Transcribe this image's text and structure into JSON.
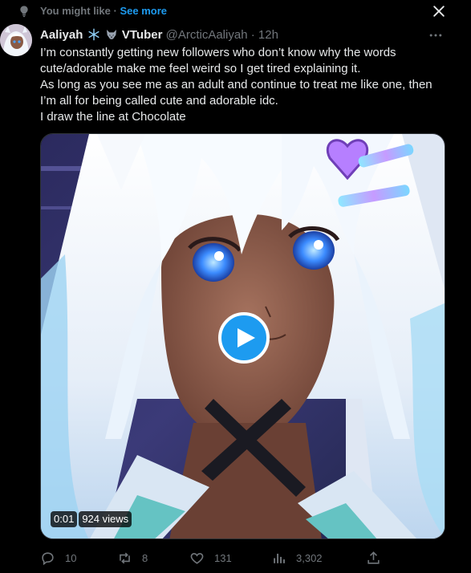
{
  "context": {
    "label": "You might like",
    "separator": "·",
    "see_more": "See more",
    "icon": "lightbulb-icon",
    "close_icon": "close-icon"
  },
  "tweet": {
    "display_name": "Aaliyah",
    "name_suffix": "VTuber",
    "badge_emojis": [
      "snowflake-icon",
      "wolf-icon"
    ],
    "handle": "@ArcticAaliyah",
    "separator": "·",
    "time": "12h",
    "more_icon": "more-icon",
    "text_lines": [
      "I’m constantly getting new followers who don’t know why the words",
      "cute/adorable make me feel weird so I get tired explaining it.",
      "As long as you see me as an adult and continue to treat me like one, then",
      "I’m all for being called cute and adorable idc.",
      "I draw the line at Chocolate"
    ],
    "media": {
      "kind": "video",
      "timestamp": "0:01",
      "views": "924 views",
      "play_icon": "play-icon"
    },
    "actions": {
      "replies": "10",
      "retweets": "8",
      "likes": "131",
      "views": "3,302"
    }
  },
  "colors": {
    "background": "#000000",
    "accent": "#1d9bf0",
    "secondary_text": "#71767b",
    "primary_text": "#e7e9ea"
  }
}
